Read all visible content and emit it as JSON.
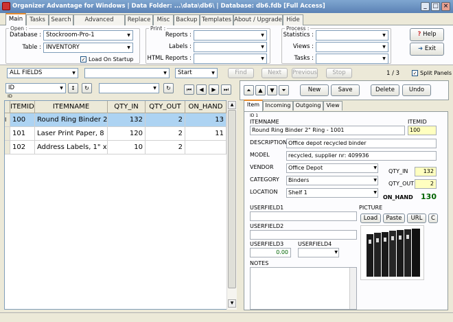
{
  "window": {
    "title": "Organizer Advantage for Windows | Data Folder: ...\\data\\db6\\ | Database: db6.fdb [Full Access]",
    "min": "_",
    "max": "□",
    "close": "×"
  },
  "tabs": [
    "Main",
    "Tasks",
    "Search",
    "Advanced Search",
    "Replace",
    "Misc",
    "Backup",
    "Templates",
    "About / Upgrade",
    "Hide"
  ],
  "open_group": {
    "legend": "Open :",
    "database_label": "Database :",
    "database_value": "Stockroom-Pro-1",
    "table_label": "Table :",
    "table_value": "INVENTORY",
    "load_on_startup": "Load On Startup",
    "load_checked": "✓"
  },
  "print_group": {
    "legend": "Print :",
    "reports_label": "Reports :",
    "labels_label": "Labels :",
    "html_label": "HTML Reports :"
  },
  "process_group": {
    "legend": "Process :",
    "statistics_label": "Statistics :",
    "views_label": "Views :",
    "tasks_label": "Tasks :"
  },
  "help_button": "Help",
  "exit_button": "Exit",
  "search_bar": {
    "field_value": "ALL FIELDS",
    "start_value": "Start",
    "find": "Find",
    "next": "Next",
    "previous": "Previous",
    "stop": "Stop",
    "page_counter": "1 / 3",
    "split_panels": "Split Panels",
    "split_checked": "✓"
  },
  "sort": {
    "field": "ID",
    "caption": "ID"
  },
  "grid": {
    "columns": [
      "ITEMID",
      "ITEMNAME",
      "QTY_IN",
      "QTY_OUT",
      "ON_HAND"
    ],
    "rows": [
      [
        "100",
        "Round Ring Binder 2",
        "132",
        "2",
        "13"
      ],
      [
        "101",
        "Laser Print Paper, 8",
        "120",
        "2",
        "11"
      ],
      [
        "102",
        "Address Labels, 1\" x",
        "10",
        "2",
        ""
      ]
    ],
    "row_marker": "I"
  },
  "record_buttons": {
    "new": "New",
    "save": "Save",
    "delete": "Delete",
    "undo": "Undo"
  },
  "detail_tabs": [
    "Item",
    "Incoming",
    "Outgoing",
    "View"
  ],
  "item": {
    "id_caption": "ID 1",
    "itemname_label": "ITEMNAME",
    "itemname": "Round Ring Binder 2\" Ring - 1001",
    "itemid_label": "ITEMID",
    "itemid": "100",
    "description_label": "DESCRIPTION",
    "description": "Office depot recycled binder",
    "model_label": "MODEL",
    "model": "recycled, supplier nr: 409936",
    "vendor_label": "VENDOR",
    "vendor": "Office Depot",
    "category_label": "CATEGORY",
    "category": "Binders",
    "location_label": "LOCATION",
    "location": "Shelf 1",
    "qty_in_label": "QTY_IN",
    "qty_in": "132",
    "qty_out_label": "QTY_OUT",
    "qty_out": "2",
    "on_hand_label": "ON_HAND",
    "on_hand": "130",
    "userfield1_label": "USERFIELD1",
    "userfield2_label": "USERFIELD2",
    "userfield3_label": "USERFIELD3",
    "userfield3": "0.00",
    "userfield4_label": "USERFIELD4",
    "notes_label": "NOTES",
    "picture_label": "PICTURE",
    "load": "Load",
    "paste": "Paste",
    "url": "URL",
    "clear": "C"
  }
}
